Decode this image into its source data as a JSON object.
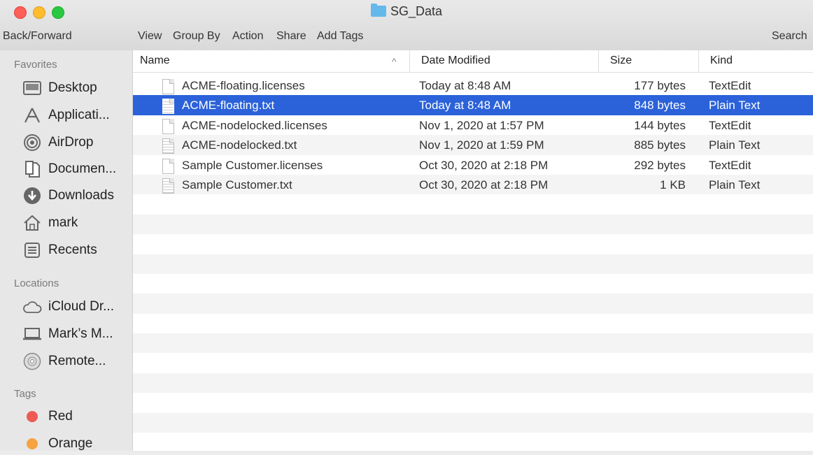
{
  "window": {
    "title": "SG_Data"
  },
  "toolbar": {
    "back_forward": "Back/Forward",
    "view": "View",
    "group_by": "Group By",
    "action": "Action",
    "share": "Share",
    "add_tags": "Add Tags",
    "search": "Search"
  },
  "sidebar": {
    "favorites_header": "Favorites",
    "favorites": [
      {
        "label": "Desktop",
        "icon": "desktop-icon"
      },
      {
        "label": "Applicati...",
        "icon": "applications-icon"
      },
      {
        "label": "AirDrop",
        "icon": "airdrop-icon"
      },
      {
        "label": "Documen...",
        "icon": "documents-icon"
      },
      {
        "label": "Downloads",
        "icon": "downloads-icon"
      },
      {
        "label": "mark",
        "icon": "home-icon"
      },
      {
        "label": "Recents",
        "icon": "recents-icon"
      }
    ],
    "locations_header": "Locations",
    "locations": [
      {
        "label": "iCloud Dr...",
        "icon": "cloud-icon"
      },
      {
        "label": "Mark’s M...",
        "icon": "laptop-icon"
      },
      {
        "label": "Remote...",
        "icon": "disc-icon"
      }
    ],
    "tags_header": "Tags",
    "tags": [
      {
        "label": "Red",
        "color": "#ee5a53"
      },
      {
        "label": "Orange",
        "color": "#f6a341"
      }
    ]
  },
  "table": {
    "columns": {
      "name": "Name",
      "date": "Date Modified",
      "size": "Size",
      "kind": "Kind"
    },
    "sort_indicator": "^",
    "rows": [
      {
        "name": "ACME-floating.licenses",
        "date": "Today at 8:48 AM",
        "size": "177 bytes",
        "kind": "TextEdit",
        "selected": false
      },
      {
        "name": "ACME-floating.txt",
        "date": "Today at 8:48 AM",
        "size": "848 bytes",
        "kind": "Plain Text",
        "selected": true
      },
      {
        "name": "ACME-nodelocked.licenses",
        "date": "Nov 1, 2020 at 1:57 PM",
        "size": "144 bytes",
        "kind": "TextEdit",
        "selected": false
      },
      {
        "name": "ACME-nodelocked.txt",
        "date": "Nov 1, 2020 at 1:59 PM",
        "size": "885 bytes",
        "kind": "Plain Text",
        "selected": false
      },
      {
        "name": "Sample Customer.licenses",
        "date": "Oct 30, 2020 at 2:18 PM",
        "size": "292 bytes",
        "kind": "TextEdit",
        "selected": false
      },
      {
        "name": "Sample Customer.txt",
        "date": "Oct 30, 2020 at 2:18 PM",
        "size": "1 KB",
        "kind": "Plain Text",
        "selected": false
      }
    ]
  },
  "colors": {
    "selection": "#2b62d9"
  }
}
